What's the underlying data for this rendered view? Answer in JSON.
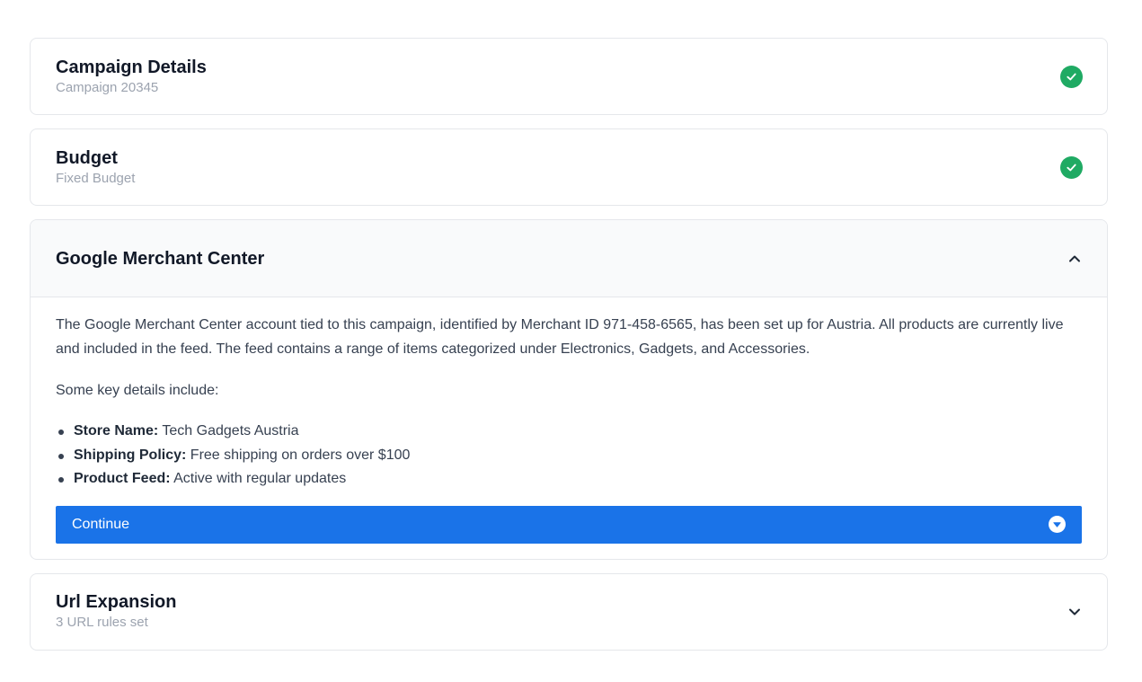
{
  "sections": {
    "campaign": {
      "title": "Campaign Details",
      "subtitle": "Campaign 20345",
      "status_icon": "check-circle-icon"
    },
    "budget": {
      "title": "Budget",
      "subtitle": "Fixed Budget",
      "status_icon": "check-circle-icon"
    },
    "merchant": {
      "title": "Google Merchant Center",
      "toggle_icon": "chevron-up-icon",
      "paragraph": "The Google Merchant Center account tied to this campaign, identified by Merchant ID 971-458-6565, has been set up for Austria. All products are currently live and included in the feed. The feed contains a range of items categorized under Electronics, Gadgets, and Accessories.",
      "intro": "Some key details include:",
      "details": [
        {
          "label": "Store Name:",
          "value": "Tech Gadgets Austria"
        },
        {
          "label": "Shipping Policy:",
          "value": "Free shipping on orders over $100"
        },
        {
          "label": "Product Feed:",
          "value": "Active with regular updates"
        }
      ],
      "continue_label": "Continue",
      "continue_icon": "chevron-down-circle-icon"
    },
    "url_expansion": {
      "title": "Url Expansion",
      "subtitle": "3 URL rules set",
      "toggle_icon": "chevron-down-icon"
    }
  },
  "colors": {
    "success": "#1faa63",
    "primary": "#1a73e8",
    "muted": "#9ca3af"
  }
}
